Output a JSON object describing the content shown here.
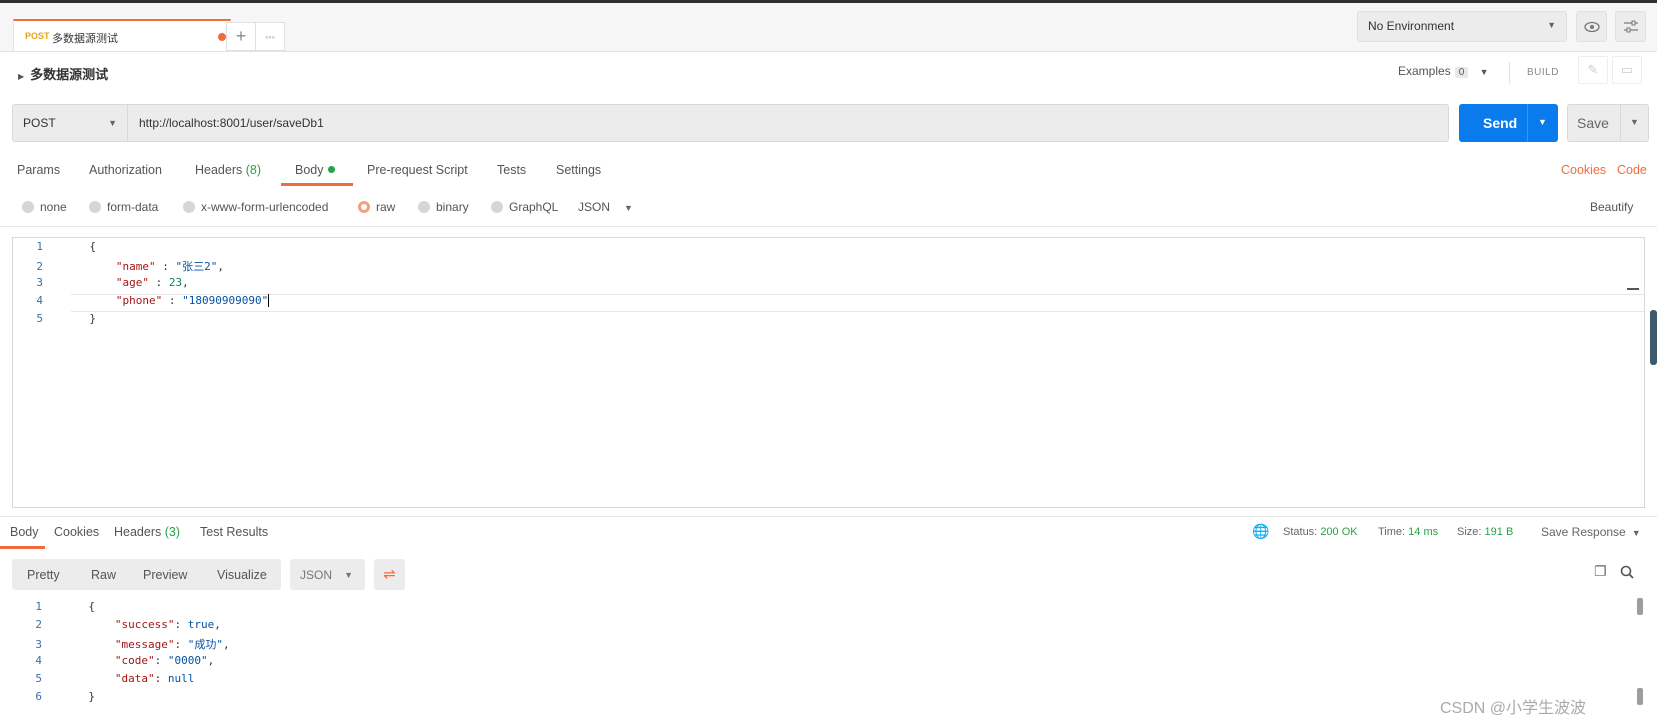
{
  "tabs": {
    "active": {
      "method": "POST",
      "name": "多数据源测试"
    },
    "add_icon": "+",
    "more_icon": "◦◦◦"
  },
  "environment": {
    "selected": "No Environment"
  },
  "breadcrumb": {
    "title": "多数据源测试"
  },
  "examples": {
    "label": "Examples",
    "count": "0"
  },
  "build_label": "BUILD",
  "request": {
    "method": "POST",
    "url": "http://localhost:8001/user/saveDb1",
    "send_label": "Send",
    "save_label": "Save"
  },
  "request_tabs": {
    "params": "Params",
    "authorization": "Authorization",
    "headers": "Headers",
    "headers_count": "(8)",
    "body": "Body",
    "prerequest": "Pre-request Script",
    "tests": "Tests",
    "settings": "Settings",
    "cookies": "Cookies",
    "code": "Code"
  },
  "body_types": {
    "none": "none",
    "form_data": "form-data",
    "urlencoded": "x-www-form-urlencoded",
    "raw": "raw",
    "binary": "binary",
    "graphql": "GraphQL",
    "format": "JSON",
    "beautify": "Beautify"
  },
  "request_body": {
    "line_numbers": [
      "1",
      "2",
      "3",
      "4",
      "5"
    ],
    "open": "{",
    "close": "}",
    "name_key": "\"name\"",
    "name_val": "\"张三2\"",
    "age_key": "\"age\"",
    "age_val": "23",
    "phone_key": "\"phone\"",
    "phone_val": "\"18090909090\""
  },
  "response_tabs": {
    "body": "Body",
    "cookies": "Cookies",
    "headers": "Headers",
    "headers_count": "(3)",
    "test_results": "Test Results"
  },
  "response_status": {
    "status_label": "Status:",
    "status_value": "200 OK",
    "time_label": "Time:",
    "time_value": "14 ms",
    "size_label": "Size:",
    "size_value": "191 B",
    "save_response": "Save Response"
  },
  "response_view": {
    "pretty": "Pretty",
    "raw": "Raw",
    "preview": "Preview",
    "visualize": "Visualize",
    "format": "JSON"
  },
  "response_body": {
    "line_numbers": [
      "1",
      "2",
      "3",
      "4",
      "5",
      "6"
    ],
    "open": "{",
    "close": "}",
    "success_key": "\"success\"",
    "success_val": "true",
    "message_key": "\"message\"",
    "message_val": "\"成功\"",
    "code_key": "\"code\"",
    "code_val": "\"0000\"",
    "data_key": "\"data\"",
    "data_val": "null"
  },
  "watermark": "CSDN @小学生波波",
  "colors": {
    "accent": "#f26b3a",
    "send": "#097bed",
    "success": "#26a346"
  }
}
